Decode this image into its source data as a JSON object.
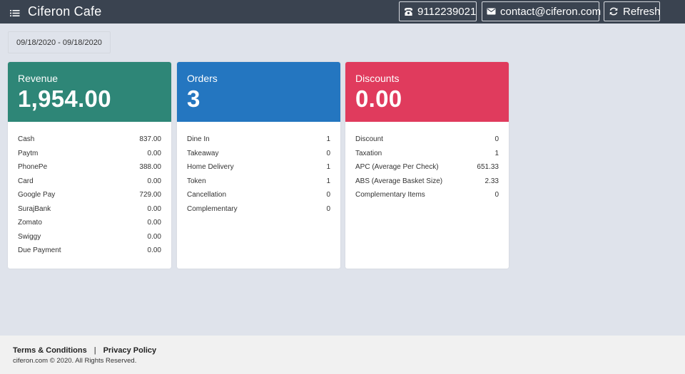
{
  "header": {
    "title": "Ciferon Cafe",
    "phone": "9112239021",
    "email": "contact@ciferon.com",
    "refresh_label": "Refresh",
    "background_color": "#3a4350"
  },
  "filter": {
    "date_range": "09/18/2020 - 09/18/2020"
  },
  "cards": {
    "revenue": {
      "label": "Revenue",
      "value": "1,954.00",
      "color": "#2e8677",
      "rows": [
        {
          "label": "Cash",
          "value": "837.00"
        },
        {
          "label": "Paytm",
          "value": "0.00"
        },
        {
          "label": "PhonePe",
          "value": "388.00"
        },
        {
          "label": "Card",
          "value": "0.00"
        },
        {
          "label": "Google Pay",
          "value": "729.00"
        },
        {
          "label": "SurajBank",
          "value": "0.00"
        },
        {
          "label": "Zomato",
          "value": "0.00"
        },
        {
          "label": "Swiggy",
          "value": "0.00"
        },
        {
          "label": "Due Payment",
          "value": "0.00"
        }
      ]
    },
    "orders": {
      "label": "Orders",
      "value": "3",
      "color": "#2476c0",
      "rows": [
        {
          "label": "Dine In",
          "value": "1"
        },
        {
          "label": "Takeaway",
          "value": "0"
        },
        {
          "label": "Home Delivery",
          "value": "1"
        },
        {
          "label": "Token",
          "value": "1"
        },
        {
          "label": "Cancellation",
          "value": "0"
        },
        {
          "label": "Complementary",
          "value": "0"
        }
      ]
    },
    "discounts": {
      "label": "Discounts",
      "value": "0.00",
      "color": "#e03b5d",
      "rows": [
        {
          "label": "Discount",
          "value": "0"
        },
        {
          "label": "Taxation",
          "value": "1"
        },
        {
          "label": "APC (Average Per Check)",
          "value": "651.33"
        },
        {
          "label": "ABS (Average Basket Size)",
          "value": "2.33"
        },
        {
          "label": "Complementary Items",
          "value": "0"
        }
      ]
    }
  },
  "footer": {
    "terms_label": "Terms & Conditions",
    "separator": "|",
    "privacy_label": "Privacy Policy",
    "copyright": "ciferon.com © 2020. All Rights Reserved."
  },
  "icons": {
    "menu": "menu-icon",
    "phone": "phone-icon",
    "email": "envelope-icon",
    "refresh": "refresh-icon"
  }
}
